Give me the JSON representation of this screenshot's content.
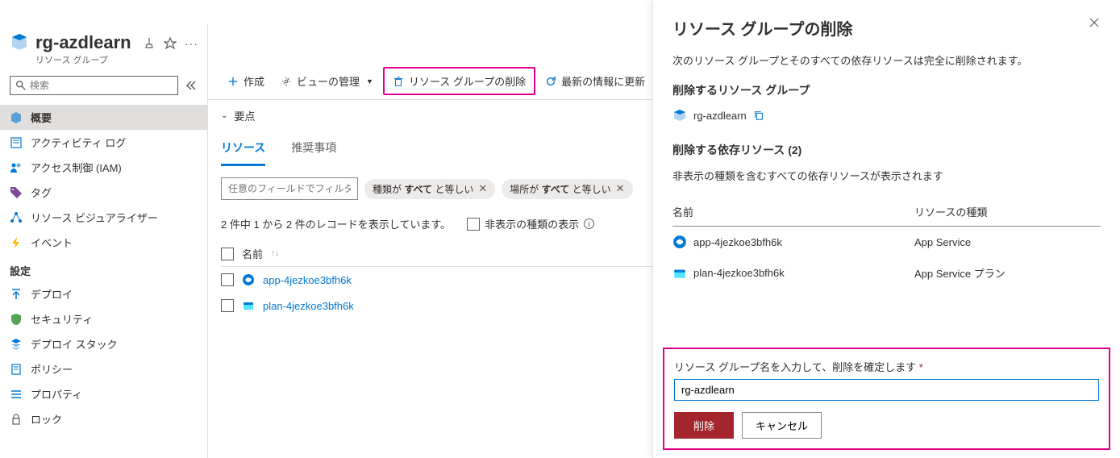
{
  "header": {
    "title": "rg-azdlearn",
    "subtitle": "リソース グループ"
  },
  "sidebar": {
    "search_placeholder": "検索",
    "items": [
      {
        "label": "概要",
        "icon": "cube"
      },
      {
        "label": "アクティビティ ログ",
        "icon": "log"
      },
      {
        "label": "アクセス制御 (IAM)",
        "icon": "people"
      },
      {
        "label": "タグ",
        "icon": "tag"
      },
      {
        "label": "リソース ビジュアライザー",
        "icon": "viz"
      },
      {
        "label": "イベント",
        "icon": "bolt"
      }
    ],
    "settings_heading": "設定",
    "settings": [
      {
        "label": "デプロイ",
        "icon": "deploy"
      },
      {
        "label": "セキュリティ",
        "icon": "shield"
      },
      {
        "label": "デプロイ スタック",
        "icon": "stack"
      },
      {
        "label": "ポリシー",
        "icon": "policy"
      },
      {
        "label": "プロパティ",
        "icon": "props"
      },
      {
        "label": "ロック",
        "icon": "lock"
      }
    ]
  },
  "toolbar": {
    "create": "作成",
    "manage_view": "ビューの管理",
    "delete_rg": "リソース グループの削除",
    "refresh": "最新の情報に更新"
  },
  "essentials_label": "要点",
  "tabs": {
    "resources": "リソース",
    "recommendations": "推奨事項"
  },
  "filters": {
    "search_placeholder": "任意のフィールドでフィルター...",
    "type_pill_prefix": "種類が ",
    "type_pill_bold": "すべて",
    "type_pill_suffix": " と等しい",
    "loc_pill_prefix": "場所が ",
    "loc_pill_bold": "すべて",
    "loc_pill_suffix": " と等しい"
  },
  "records": {
    "count_text": "2 件中 1 から 2 件のレコードを表示しています。",
    "show_hidden": "非表示の種類の表示"
  },
  "table": {
    "name_header": "名前",
    "rows": [
      {
        "name": "app-4jezkoe3bfh6k"
      },
      {
        "name": "plan-4jezkoe3bfh6k"
      }
    ]
  },
  "panel": {
    "title": "リソース グループの削除",
    "warning": "次のリソース グループとそのすべての依存リソースは完全に削除されます。",
    "rg_heading": "削除するリソース グループ",
    "rg_name": "rg-azdlearn",
    "deps_heading": "削除する依存リソース (2)",
    "deps_note": "非表示の種類を含むすべての依存リソースが表示されます",
    "col_name": "名前",
    "col_type": "リソースの種類",
    "deps": [
      {
        "name": "app-4jezkoe3bfh6k",
        "type": "App Service"
      },
      {
        "name": "plan-4jezkoe3bfh6k",
        "type": "App Service プラン"
      }
    ],
    "confirm_label": "リソース グループ名を入力して、削除を確定します",
    "confirm_value": "rg-azdlearn",
    "delete_btn": "削除",
    "cancel_btn": "キャンセル"
  }
}
